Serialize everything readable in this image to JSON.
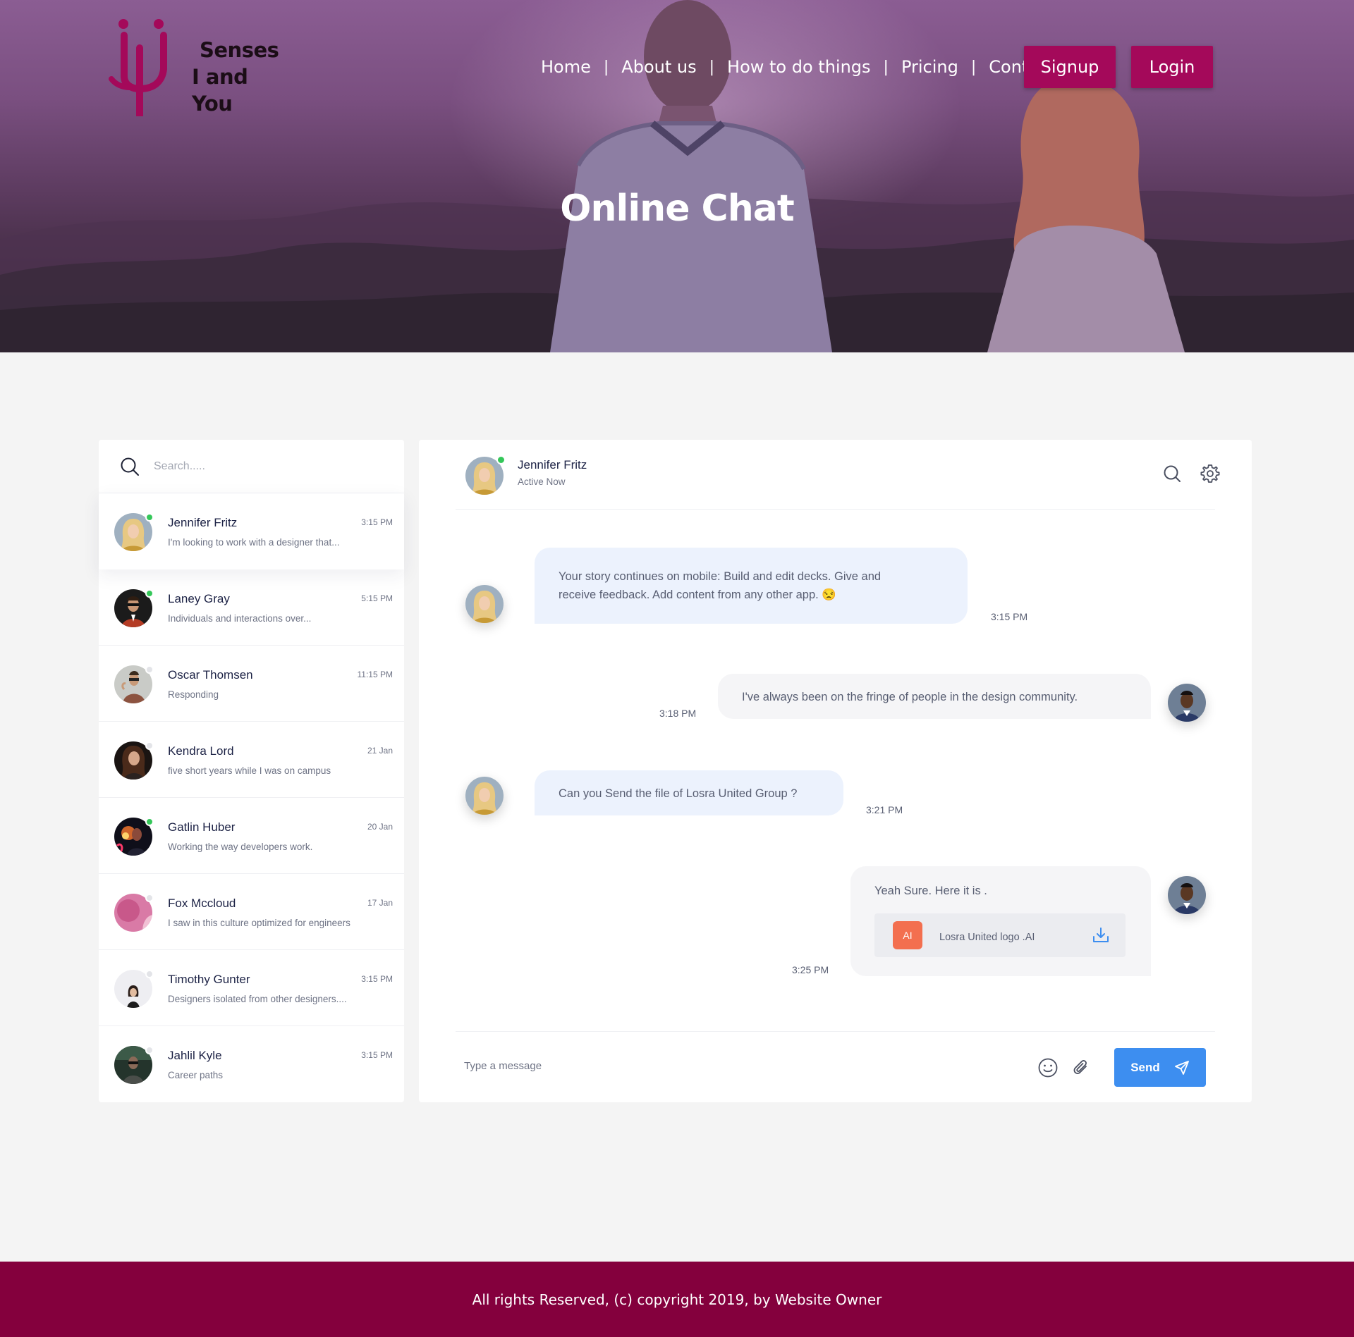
{
  "brand": {
    "line1": "Senses",
    "line2": "I and You",
    "color": "#a4095a"
  },
  "nav": {
    "links": [
      "Home",
      "About us",
      "How to do things",
      "Pricing",
      "Contact"
    ],
    "separator": "|",
    "signup_label": "Signup",
    "login_label": "Login"
  },
  "hero": {
    "title": "Online Chat"
  },
  "search": {
    "placeholder": "Search.....",
    "icon": "search-icon"
  },
  "contacts": [
    {
      "name": "Jennifer Fritz",
      "time": "3:15 PM",
      "preview": "I'm looking to work with a designer that...",
      "online": true,
      "active": true
    },
    {
      "name": "Laney Gray",
      "time": "5:15 PM",
      "preview": "Individuals and interactions over...",
      "online": true
    },
    {
      "name": "Oscar Thomsen",
      "time": "11:15 PM",
      "preview": "Responding",
      "online": false
    },
    {
      "name": "Kendra Lord",
      "time": "21 Jan",
      "preview": "five short years while I was on campus",
      "online": false
    },
    {
      "name": "Gatlin Huber",
      "time": "20 Jan",
      "preview": "Working the way developers work.",
      "online": true
    },
    {
      "name": "Fox Mccloud",
      "time": "17 Jan",
      "preview": "I saw in this culture optimized for engineers",
      "online": false
    },
    {
      "name": "Timothy Gunter",
      "time": "3:15 PM",
      "preview": "Designers isolated from other designers....",
      "online": false
    },
    {
      "name": "Jahlil Kyle",
      "time": "3:15 PM",
      "preview": "Career paths",
      "online": false
    }
  ],
  "chat": {
    "header": {
      "name": "Jennifer Fritz",
      "status": "Active Now"
    },
    "messages": [
      {
        "direction": "in",
        "line1": "Your story continues on mobile: Build and edit decks. Give and",
        "line2": "receive feedback. Add content from any other app. 😒",
        "time": "3:15 PM"
      },
      {
        "direction": "out",
        "text": "I've always been on the fringe of people in the design community.",
        "time": "3:18 PM"
      },
      {
        "direction": "in",
        "text": "Can you Send the file of Losra United Group ?",
        "time": "3:21 PM"
      },
      {
        "direction": "out",
        "text": "Yeah Sure. Here it is .",
        "time": "3:25 PM",
        "attachment": {
          "badge": "AI",
          "name": "Losra United logo .AI"
        }
      }
    ],
    "composer": {
      "placeholder": "Type a message",
      "send_label": "Send"
    }
  },
  "footer": {
    "text": "All rights Reserved, (c) copyright 2019, by Website Owner"
  },
  "colors": {
    "accent_blue": "#3d8ef0",
    "online_green": "#34c759",
    "offline_gray": "#e3e4e8",
    "footer_bg": "#84003d",
    "file_badge": "#f36f4f"
  }
}
